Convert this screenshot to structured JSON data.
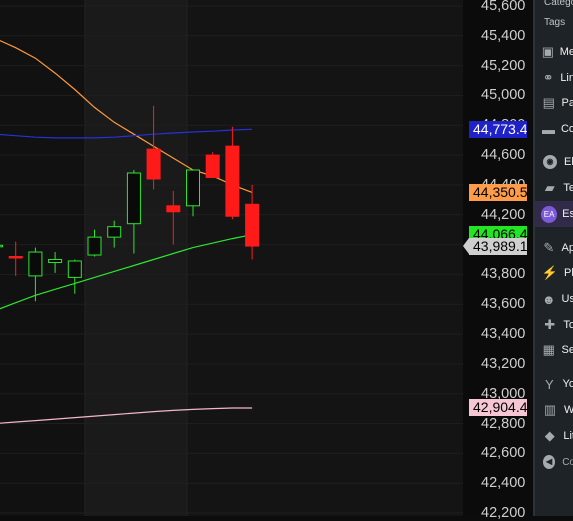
{
  "chart_data": {
    "type": "candlestick",
    "y_ticks": [
      "45,600",
      "45,400",
      "45,200",
      "45,000",
      "44,800",
      "44,600",
      "44,400",
      "44,200",
      "44,000",
      "43,800",
      "43,600",
      "43,400",
      "43,200",
      "43,000",
      "42,800",
      "42,600",
      "42,400",
      "42,200"
    ],
    "ylim": [
      42180,
      45640
    ],
    "candles": [
      {
        "o": 43985,
        "h": 44080,
        "l": 43920,
        "c": 43995
      },
      {
        "o": 43920,
        "h": 44020,
        "l": 43790,
        "c": 43910
      },
      {
        "o": 43790,
        "h": 43980,
        "l": 43620,
        "c": 43950
      },
      {
        "o": 43880,
        "h": 43950,
        "l": 43810,
        "c": 43900
      },
      {
        "o": 43780,
        "h": 43900,
        "l": 43670,
        "c": 43890
      },
      {
        "o": 43930,
        "h": 44100,
        "l": 43920,
        "c": 44050
      },
      {
        "o": 44050,
        "h": 44160,
        "l": 43980,
        "c": 44120
      },
      {
        "o": 44140,
        "h": 44500,
        "l": 43940,
        "c": 44480
      },
      {
        "o": 44640,
        "h": 44930,
        "l": 44370,
        "c": 44440
      },
      {
        "o": 44260,
        "h": 44360,
        "l": 44000,
        "c": 44220
      },
      {
        "o": 44260,
        "h": 44500,
        "l": 44190,
        "c": 44500
      },
      {
        "o": 44600,
        "h": 44620,
        "l": 44450,
        "c": 44450
      },
      {
        "o": 44660,
        "h": 44790,
        "l": 44170,
        "c": 44190
      },
      {
        "o": 44270,
        "h": 44400,
        "l": 43900,
        "c": 43990
      }
    ],
    "overlays": [
      {
        "name": "orange-ma",
        "color": "#ff9a3c",
        "values": [
          45380,
          45320,
          45250,
          45150,
          45040,
          44920,
          44820,
          44740,
          44660,
          44580,
          44500,
          44460,
          44400,
          44350
        ]
      },
      {
        "name": "green-ma",
        "color": "#2ee52e",
        "values": [
          43560,
          43610,
          43660,
          43700,
          43740,
          43780,
          43820,
          43860,
          43900,
          43940,
          43980,
          44010,
          44040,
          44066
        ]
      },
      {
        "name": "blue-ma",
        "color": "#2731d8",
        "values": [
          44740,
          44730,
          44720,
          44715,
          44715,
          44715,
          44720,
          44730,
          44740,
          44748,
          44755,
          44760,
          44768,
          44773
        ]
      },
      {
        "name": "pink-ma",
        "color": "#f3b8c8",
        "values": [
          42800,
          42810,
          42820,
          42830,
          42840,
          42850,
          42860,
          42870,
          42880,
          42888,
          42895,
          42900,
          42904,
          42904
        ]
      }
    ],
    "price_tags": [
      {
        "label": "44,773.4",
        "value": 44773.4,
        "bg": "#1f22c8",
        "fg": "#ffffff"
      },
      {
        "label": "44,350.5",
        "value": 44350.5,
        "bg": "#ff9c4a",
        "fg": "#000000"
      },
      {
        "label": "44,066.4",
        "value": 44066.4,
        "bg": "#22e622",
        "fg": "#000000"
      },
      {
        "label": "43,989.1",
        "value": 43989.1,
        "bg": "#cfcfcf",
        "fg": "#000000"
      },
      {
        "label": "42,904.4",
        "value": 42904.4,
        "bg": "#f6c6d2",
        "fg": "#000000"
      }
    ],
    "grid": true
  },
  "menu": {
    "top_items": [
      "Catego",
      "Tags"
    ],
    "items": [
      {
        "icon": "media-icon",
        "glyph": "▣",
        "label": "Me"
      },
      {
        "icon": "links-icon",
        "glyph": "⚭",
        "label": "Lin"
      },
      {
        "icon": "pages-icon",
        "glyph": "▤",
        "label": "Pa"
      },
      {
        "icon": "comments-icon",
        "glyph": "▬",
        "label": "Co"
      },
      {
        "icon": "elementor-icon",
        "glyph": "◉",
        "label": "El"
      },
      {
        "icon": "templates-icon",
        "glyph": "▰",
        "label": "Te"
      },
      {
        "icon": "essential-addons-icon",
        "glyph": "EA",
        "label": "Es"
      },
      {
        "icon": "appearance-icon",
        "glyph": "✎",
        "label": "Ap"
      },
      {
        "icon": "plugins-icon",
        "glyph": "⚡",
        "label": "Pl"
      },
      {
        "icon": "users-icon",
        "glyph": "☻",
        "label": "Us"
      },
      {
        "icon": "tools-icon",
        "glyph": "✚",
        "label": "To"
      },
      {
        "icon": "settings-icon",
        "glyph": "▦",
        "label": "Se"
      },
      {
        "icon": "yoast-icon",
        "glyph": "Y",
        "label": "Yo"
      },
      {
        "icon": "wordfence-icon",
        "glyph": "▥",
        "label": "W"
      },
      {
        "icon": "litespeed-icon",
        "glyph": "◆",
        "label": "Lit"
      },
      {
        "icon": "collapse-icon",
        "glyph": "◀",
        "label": "Co"
      }
    ]
  }
}
